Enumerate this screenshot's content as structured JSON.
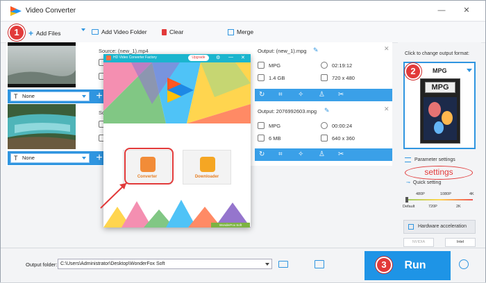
{
  "window": {
    "title": "Video Converter",
    "minimize": "—",
    "close": "✕"
  },
  "toolbar": {
    "add_files": "Add Files",
    "add_video_folder": "Add Video Folder",
    "clear": "Clear",
    "merge": "Merge"
  },
  "badges": {
    "one": "1",
    "two": "2",
    "three": "3"
  },
  "files": [
    {
      "source": "Source: (new_1).mp4",
      "output": "Output: (new_1).mpg",
      "format": "MPG",
      "duration": "02:19:12",
      "size": "1.4 GB",
      "resolution": "720 x 480",
      "subtitle": "None"
    },
    {
      "source": "Sour",
      "output": "Output: 2076992603.mpg",
      "format": "MPG",
      "duration": "00:00:24",
      "size": "6 MB",
      "resolution": "640 x 360",
      "subtitle": "None"
    }
  ],
  "right_panel": {
    "title": "Click to change output format:",
    "format": "MPG",
    "file_icon_label": "MPG",
    "parameter_settings": "Parameter settings",
    "settings_annotation": "settings",
    "quick_setting": "Quick setting",
    "ticks_top": [
      "480P",
      "1080P",
      "4K"
    ],
    "ticks_bottom": [
      "Default",
      "720P",
      "2K"
    ],
    "hardware_acceleration": "Hardware acceleration",
    "gpu_nvidia": "NVIDIA",
    "gpu_intel": "Intel"
  },
  "popup": {
    "title": "HD Video Converter Factory",
    "upgrade": "Upgrade",
    "converter": "Converter",
    "downloader": "Downloader",
    "brand": "WonderFox Soft"
  },
  "bottom": {
    "output_folder_label": "Output folder:",
    "output_path": "C:\\Users\\Administrator\\Desktop\\WonderFox Soft",
    "run": "Run"
  },
  "colors": {
    "accent": "#2f95e0",
    "annotation_red": "#e23a3a",
    "popup_header": "#1bb5ce"
  }
}
